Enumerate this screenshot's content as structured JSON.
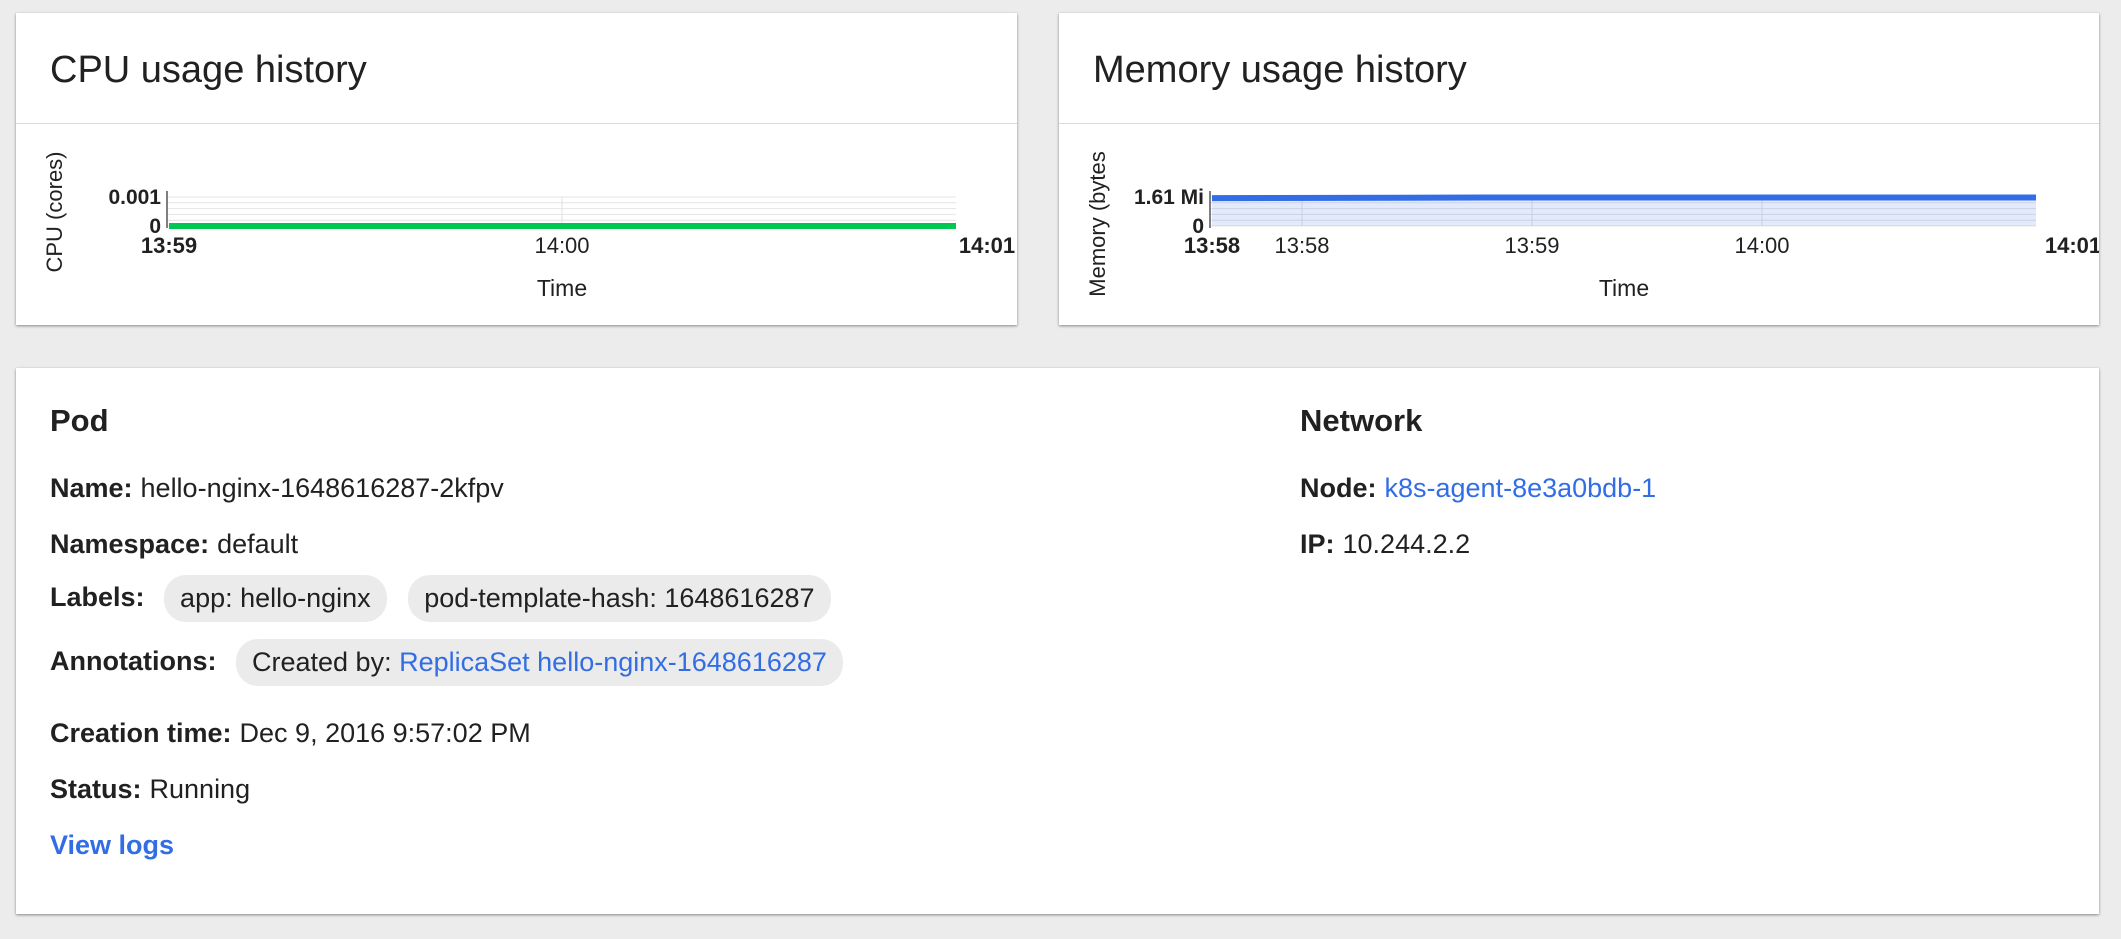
{
  "cpu_card": {
    "title": "CPU usage history"
  },
  "memory_card": {
    "title": "Memory usage history"
  },
  "pod": {
    "section_title": "Pod",
    "name_label": "Name:",
    "name_value": "hello-nginx-1648616287-2kfpv",
    "namespace_label": "Namespace:",
    "namespace_value": "default",
    "labels_label": "Labels:",
    "labels": [
      "app: hello-nginx",
      "pod-template-hash: 1648616287"
    ],
    "annotations_label": "Annotations:",
    "annotation_prefix": "Created by:",
    "annotation_link": "ReplicaSet hello-nginx-1648616287",
    "creation_time_label": "Creation time:",
    "creation_time_value": "Dec 9, 2016 9:57:02 PM",
    "status_label": "Status:",
    "status_value": "Running",
    "view_logs": "View logs"
  },
  "network": {
    "section_title": "Network",
    "node_label": "Node:",
    "node_value": "k8s-agent-8e3a0bdb-1",
    "ip_label": "IP:",
    "ip_value": "10.244.2.2"
  },
  "colors": {
    "cpu_series": "#00c752",
    "memory_series": "#326de6",
    "link": "#326de6"
  },
  "chart_data": [
    {
      "type": "area",
      "xlabel": "Time",
      "ylabel": "CPU (cores)",
      "x": [
        "13:59",
        "14:00",
        "14:01"
      ],
      "x_tick_labels": [
        "13:59",
        "14:00",
        "14:01"
      ],
      "x_bold_ticks": [
        "13:59",
        "14:01"
      ],
      "y_tick_labels": [
        "0.001",
        "0"
      ],
      "ylim": [
        0,
        0.001
      ],
      "series": [
        {
          "values": [
            0,
            0,
            0
          ]
        }
      ]
    },
    {
      "type": "area",
      "xlabel": "Time",
      "ylabel": "Memory (bytes",
      "x": [
        "13:58",
        "13:59",
        "14:00",
        "14:01"
      ],
      "x_tick_labels": [
        "13:58",
        "13:58",
        "13:59",
        "14:00",
        "14:01"
      ],
      "x_bold_ticks": [
        "13:58",
        "14:01"
      ],
      "y_tick_labels": [
        "1.61 Mi",
        "0"
      ],
      "ylim": [
        0,
        1.61
      ],
      "series": [
        {
          "values": [
            1.55,
            1.58,
            1.58,
            1.58
          ]
        }
      ]
    }
  ]
}
